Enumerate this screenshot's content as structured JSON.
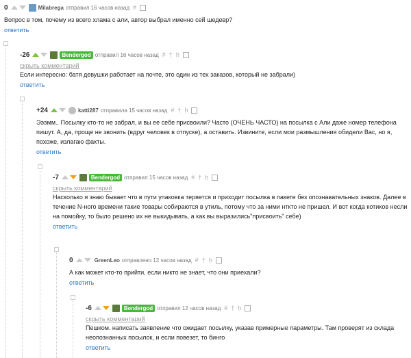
{
  "comments": [
    {
      "rating": "0",
      "user": "Milabrega",
      "posted": "отправил 16 часов назад",
      "text": "Вопрос в том, почему из всего хлама с али, автор выбрал именно сей шедевр?",
      "reply": "ответить"
    },
    {
      "rating": "-26",
      "user": "Bendergod",
      "posted": "отправил 16 часов назад",
      "hide": "скрыть комментарий",
      "text": "Если интересно: батя девушки работает на почте, это один из тех заказов, который не забрали)",
      "reply": "ответить"
    },
    {
      "rating": "+24",
      "user": "katti287",
      "posted": "отправила 15 часов назад",
      "text": "Эээмм.. Посылку кто-то не забрал, и вы ее себе присвоили? Часто (ОЧЕНЬ ЧАСТО) на посылка с Али даже номер телефона пишут. А, да, проще не звонить (вдруг человек в отпуске), а оставить. Извините, если мои размышления обидели Вас, но я, похоже, излагаю факты.",
      "reply": "ответить"
    },
    {
      "rating": "-7",
      "user": "Bendergod",
      "posted": "отправил 15 часов назад",
      "hide": "скрыть комментарий",
      "text": "Насколько я знаю бывает что в пути упаковка теряется и приходит посылка в пакете без опознавательных знаков. Далее в течение N-ного времени такие товары собираются в утиль, потому что за ними нткто не пришел. И вот когда котиков несли на помойку, то было решено их не выкидывать, а как вы выразились\"присвоить\" себе)",
      "reply": "ответить"
    },
    {
      "rating": "0",
      "user": "GreenLeo",
      "posted": "отправлено 12 часов назад",
      "text": "А как может кто-то прийти, если никто не знает, что они приехали?",
      "reply": "ответить"
    },
    {
      "rating": "-6",
      "user": "Bendergod",
      "posted": "отправил 12 часов назад",
      "hide": "скрыть комментарий",
      "text": "Пешком. написать заявление что ожидает посылку, указав примерные параметры. Там проверят из склада неопознанных посылок, и если повезет, то бинго",
      "reply": "ответить"
    }
  ],
  "tool_icons": {
    "hash": "#",
    "pin": "†",
    "branch": "ḥ"
  },
  "colors": {
    "badge": "#48b93b",
    "upvote": "#7bc142",
    "downvote": "#f0a020",
    "link": "#2a76c4"
  }
}
